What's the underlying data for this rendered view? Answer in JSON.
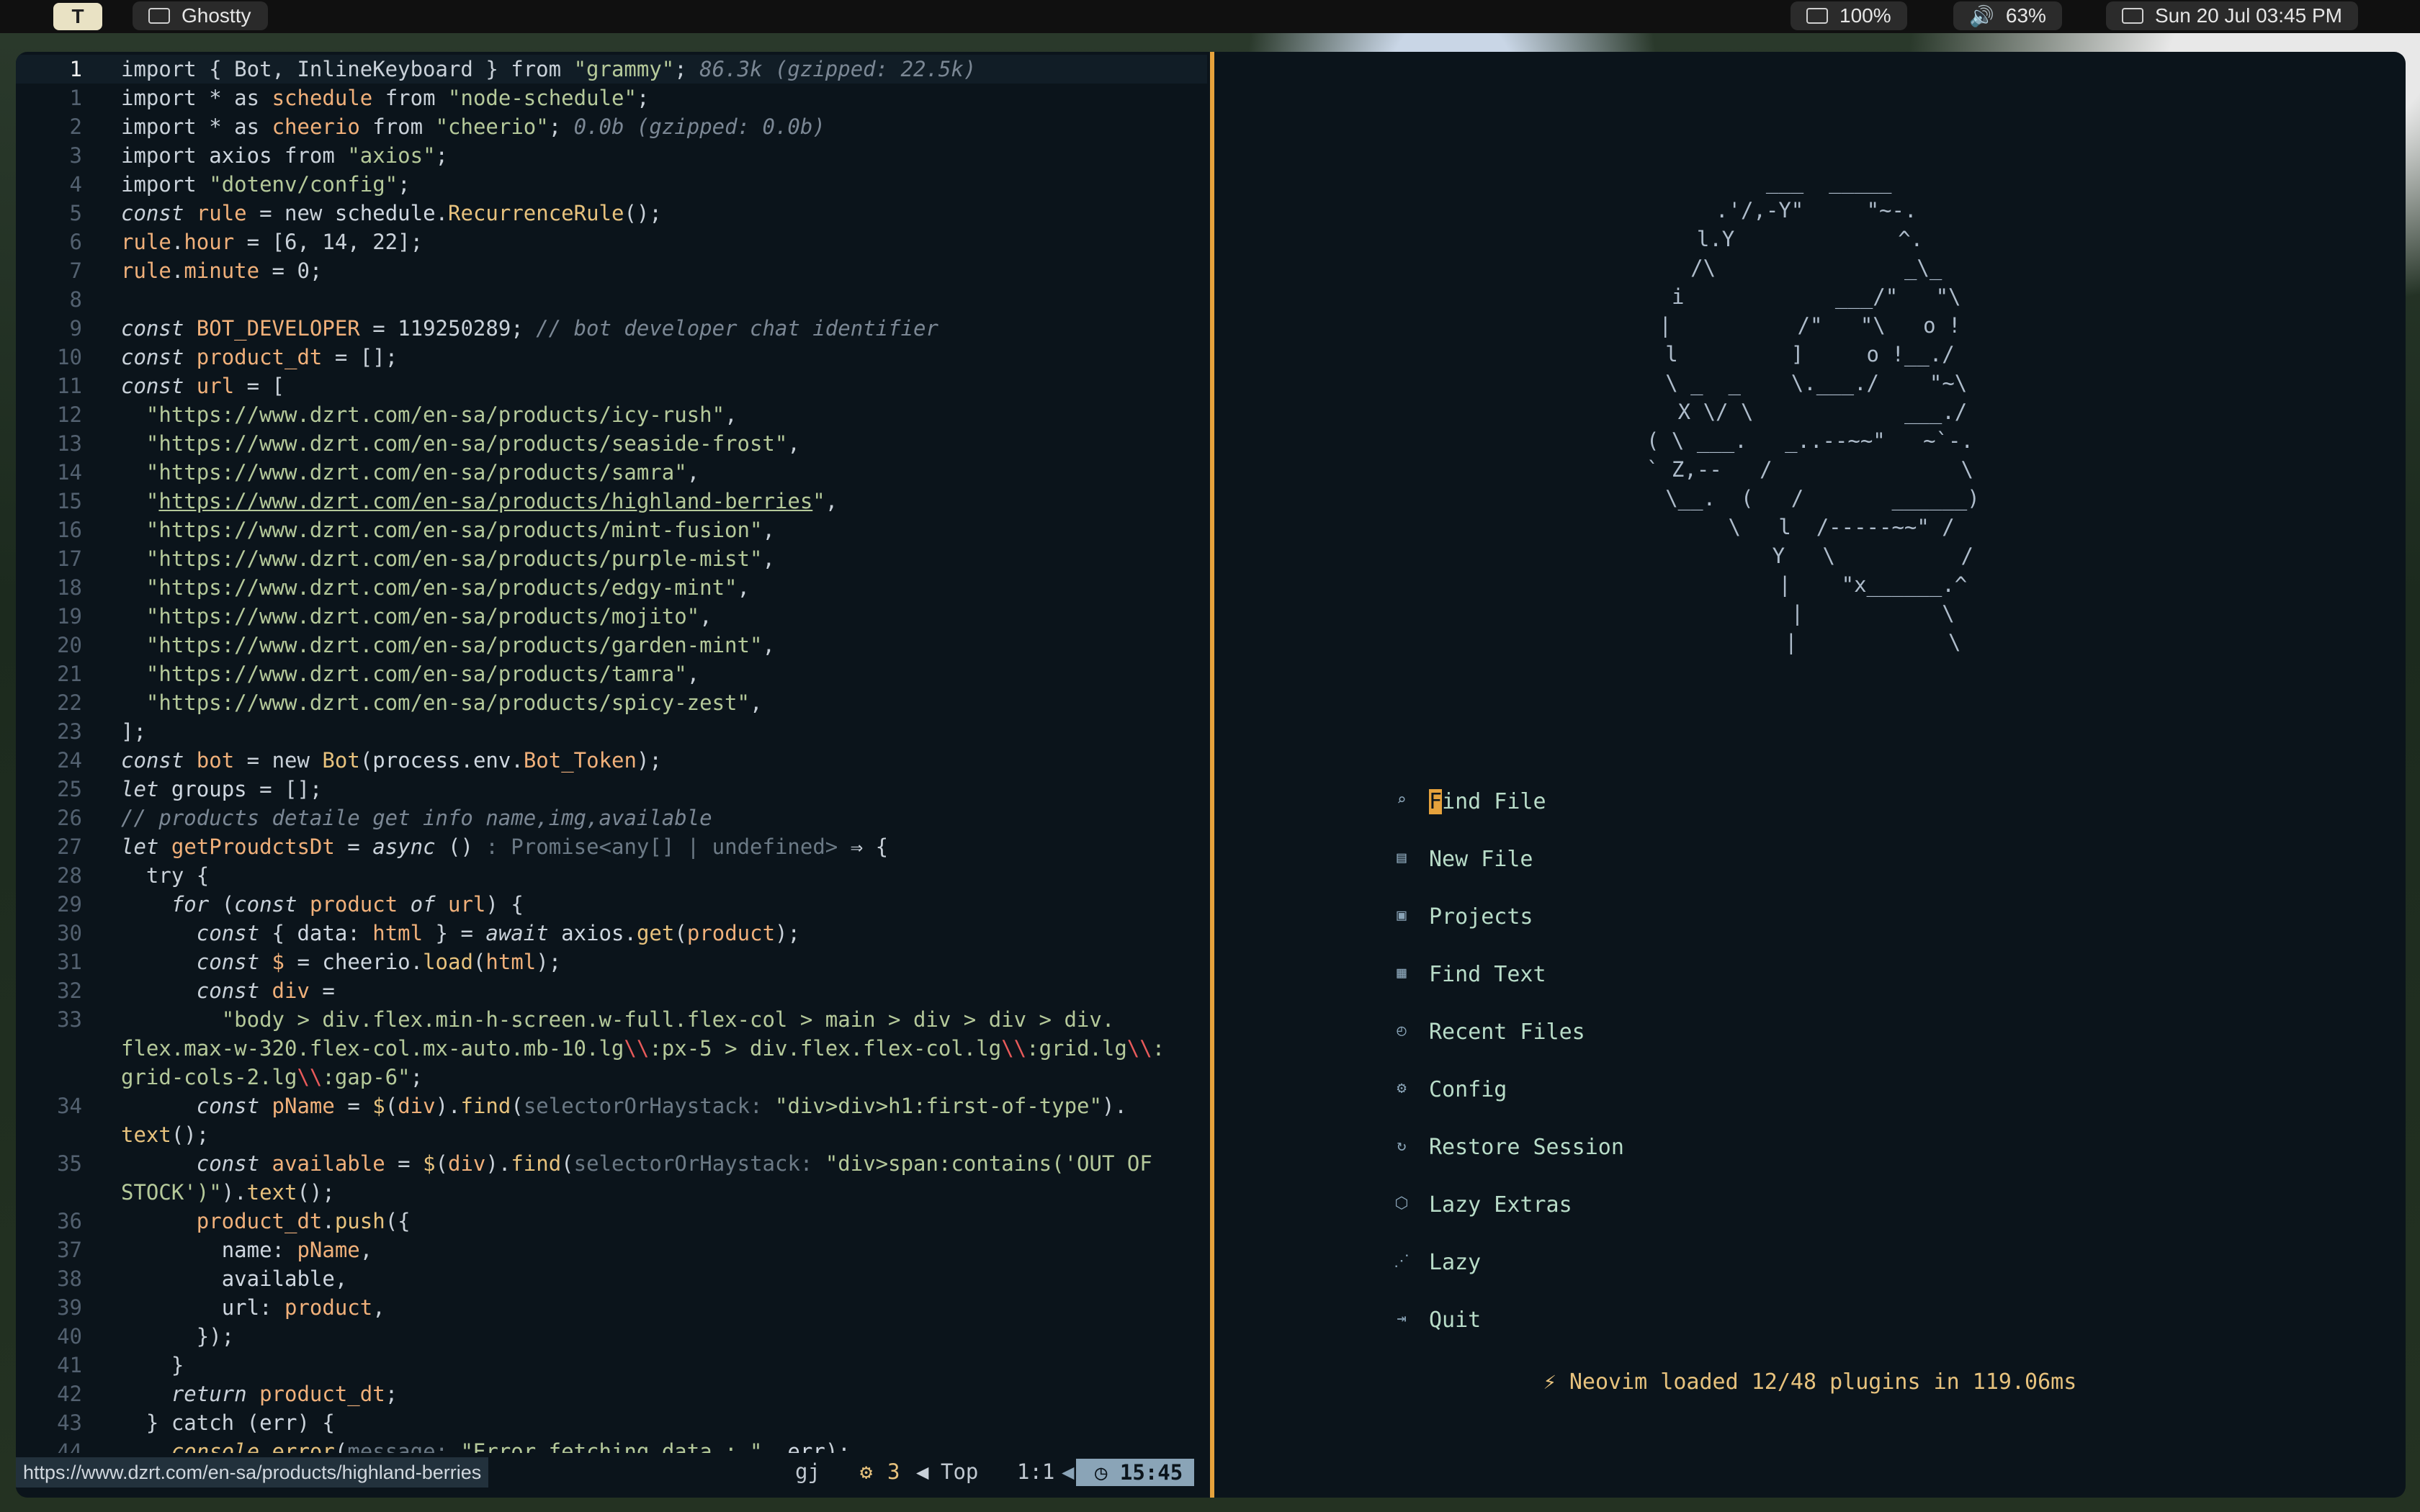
{
  "topbar": {
    "workspace": "T",
    "app_name": "Ghostty",
    "battery": "100%",
    "volume": "63%",
    "datetime": "Sun 20 Jul 03:45 PM"
  },
  "editor": {
    "lines": [
      {
        "n": "1",
        "cur": true,
        "html": "<span class='k'>import</span> { Bot, InlineKeyboard } <span class='k'>from</span> <span class='s'>\"grammy\"</span>; <span class='c'>86.3k (gzipped: 22.5k)</span>"
      },
      {
        "n": "1",
        "html": "<span class='k'>import</span> <span class='k'>*</span> <span class='k'>as</span> <span class='v'>schedule</span> <span class='k'>from</span> <span class='s'>\"node-schedule\"</span>;"
      },
      {
        "n": "2",
        "html": "<span class='k'>import</span> <span class='k'>*</span> <span class='k'>as</span> <span class='v'>cheerio</span> <span class='k'>from</span> <span class='s'>\"cheerio\"</span>; <span class='c'>0.0b (gzipped: 0.0b)</span>"
      },
      {
        "n": "3",
        "html": "<span class='k'>import</span> <span class='f'>axios</span> <span class='k'>from</span> <span class='s'>\"axios\"</span>;"
      },
      {
        "n": "4",
        "html": "<span class='k'>import</span> <span class='s'>\"dotenv/config\"</span>;"
      },
      {
        "n": "5",
        "html": "<span class='c' style='font-style:italic;color:#c9d1d9'>const</span> <span class='v'>rule</span> = <span class='k'>new</span> <span class='f'>schedule</span>.<span class='n'>RecurrenceRule</span>();"
      },
      {
        "n": "6",
        "html": "<span class='v'>rule</span>.<span class='v'>hour</span> = [6, 14, 22];"
      },
      {
        "n": "7",
        "html": "<span class='v'>rule</span>.<span class='v'>minute</span> = 0;"
      },
      {
        "n": "8",
        "html": ""
      },
      {
        "n": "9",
        "html": "<i>const</i> <span class='v'>BOT_DEVELOPER</span> = 119250289; <span class='c'>// bot developer chat identifier</span>"
      },
      {
        "n": "10",
        "html": "<i>const</i> <span class='v'>product_dt</span> = [];"
      },
      {
        "n": "11",
        "html": "<i>const</i> <span class='v'>url</span> = ["
      },
      {
        "n": "12",
        "html": "  <span class='s'>\"https://www.dzrt.com/en-sa/products/icy-rush\"</span>,"
      },
      {
        "n": "13",
        "html": "  <span class='s'>\"https://www.dzrt.com/en-sa/products/seaside-frost\"</span>,"
      },
      {
        "n": "14",
        "html": "  <span class='s'>\"https://www.dzrt.com/en-sa/products/samra\"</span>,"
      },
      {
        "n": "15",
        "html": "  <span class='s'>\"<span class='u'>https://www.dzrt.com/en-sa/products/highland-berries</span>\"</span>,"
      },
      {
        "n": "16",
        "html": "  <span class='s'>\"https://www.dzrt.com/en-sa/products/mint-fusion\"</span>,"
      },
      {
        "n": "17",
        "html": "  <span class='s'>\"https://www.dzrt.com/en-sa/products/purple-mist\"</span>,"
      },
      {
        "n": "18",
        "html": "  <span class='s'>\"https://www.dzrt.com/en-sa/products/edgy-mint\"</span>,"
      },
      {
        "n": "19",
        "html": "  <span class='s'>\"https://www.dzrt.com/en-sa/products/mojito\"</span>,"
      },
      {
        "n": "20",
        "html": "  <span class='s'>\"https://www.dzrt.com/en-sa/products/garden-mint\"</span>,"
      },
      {
        "n": "21",
        "html": "  <span class='s'>\"https://www.dzrt.com/en-sa/products/tamra\"</span>,"
      },
      {
        "n": "22",
        "html": "  <span class='s'>\"https://www.dzrt.com/en-sa/products/spicy-zest\"</span>,"
      },
      {
        "n": "23",
        "html": "];"
      },
      {
        "n": "24",
        "html": "<i>const</i> <span class='v'>bot</span> = <span class='k'>new</span> <span class='n'>Bot</span>(<span class='f'>process</span>.<span class='f'>env</span>.<span class='v'>Bot_Token</span>);"
      },
      {
        "n": "25",
        "html": "<i>let</i> <span class='f'>groups</span> = [];"
      },
      {
        "n": "26",
        "html": "<span class='c'>// products detaile get info name,img,available</span>"
      },
      {
        "n": "27",
        "html": "<i>let</i> <span class='v'>getProudctsDt</span> = <i>async</i> () <span class='h'>: Promise&lt;any[] | undefined&gt;</span> ⇒ {"
      },
      {
        "n": "28",
        "html": "  <span class='k'>try</span> {"
      },
      {
        "n": "29",
        "html": "    <i>for</i> (<i>const</i> <span class='v'>product</span> <i>of</i> <span class='v'>url</span>) {"
      },
      {
        "n": "30",
        "html": "      <i>const</i> { <span class='f'>data</span>: <span class='v'>html</span> } = <i>await</i> <span class='f'>axios</span>.<span class='n'>get</span>(<span class='v'>product</span>);"
      },
      {
        "n": "31",
        "html": "      <i>const</i> <span class='v'>$</span> = <span class='f'>cheerio</span>.<span class='n'>load</span>(<span class='v'>html</span>);"
      },
      {
        "n": "32",
        "html": "      <i>const</i> <span class='v'>div</span> ="
      },
      {
        "n": "33",
        "html": "        <span class='s'>\"body &gt; div.flex.min-h-screen.w-full.flex-col &gt; main &gt; div &gt; div &gt; div.</span>"
      },
      {
        "n": "",
        "html": "<span class='s'>flex.max-w-320.flex-col.mx-auto.mb-10.lg<span class='em'>\\\\</span>:px-5 &gt; div.flex.flex-col.lg<span class='em'>\\\\</span>:grid.lg<span class='em'>\\\\</span>:</span>"
      },
      {
        "n": "",
        "html": "<span class='s'>grid-cols-2.lg<span class='em'>\\\\</span>:gap-6\"</span>;"
      },
      {
        "n": "34",
        "html": "      <i>const</i> <span class='v'>pName</span> = <span class='n'>$</span>(<span class='v'>div</span>).<span class='n'>find</span>(<span class='h'>selectorOrHaystack:</span> <span class='s'>\"div&gt;div&gt;h1:first-of-type\"</span>)."
      },
      {
        "n": "",
        "html": "<span class='n'>text</span>();"
      },
      {
        "n": "35",
        "html": "      <i>const</i> <span class='v'>available</span> = <span class='n'>$</span>(<span class='v'>div</span>).<span class='n'>find</span>(<span class='h'>selectorOrHaystack:</span> <span class='s'>\"div&gt;span:contains('OUT OF</span>"
      },
      {
        "n": "",
        "html": "<span class='s'>STOCK')\"</span>).<span class='n'>text</span>();"
      },
      {
        "n": "36",
        "html": "      <span class='v'>product_dt</span>.<span class='n'>push</span>({"
      },
      {
        "n": "37",
        "html": "        <span class='f'>name</span>: <span class='v'>pName</span>,"
      },
      {
        "n": "38",
        "html": "        <span class='f'>available</span>,"
      },
      {
        "n": "39",
        "html": "        <span class='f'>url</span>: <span class='v'>product</span>,"
      },
      {
        "n": "40",
        "html": "      });"
      },
      {
        "n": "41",
        "html": "    }"
      },
      {
        "n": "42",
        "html": "    <i>return</i> <span class='v'>product_dt</span>;"
      },
      {
        "n": "43",
        "html": "  } <span class='k'>catch</span> (<span class='f'>err</span>) {"
      },
      {
        "n": "44",
        "html": "    <i><span class='n'>console</span></i>.<span class='n'>error</span>(<span class='h'>message:</span> <span class='s'>\"Error fetching data : \"</span>, <span class='f'>err</span>);"
      }
    ],
    "status": {
      "url_tip": "https://www.dzrt.com/en-sa/products/highland-berries",
      "keys": "gj",
      "diagnostics": "3",
      "position": "Top",
      "cursor": "1:1",
      "time": "15:45"
    }
  },
  "dashboard": {
    "logo": "   ___  _____\n .'/,-Y\"     \"~-.\nl.Y             ^.\n /\\               _\\_\n i            ___/\"   \"\\\n|          /\"   \"\\   o !\nl         ]     o !__./\n \\ _  _    \\.___./    \"~\\\n  X \\/ \\            ___./\n( \\ ___.   _..--~~\"   ~`-.\n` Z,--   /               \\\n  \\__.  (   /       ______)\n     \\   l  /-----~~\" /\n          Y   \\          /\n          |    \"x______.^\n          |           \\\n          |            \\",
    "items": [
      {
        "icon": "search-icon",
        "glyph": "⌕",
        "label": "Find File",
        "key": "f"
      },
      {
        "icon": "new-file-icon",
        "glyph": "▤",
        "label": "New File",
        "key": "n"
      },
      {
        "icon": "projects-icon",
        "glyph": "▣",
        "label": "Projects",
        "key": "p"
      },
      {
        "icon": "find-text-icon",
        "glyph": "▦",
        "label": "Find Text",
        "key": "g"
      },
      {
        "icon": "recent-files-icon",
        "glyph": "◴",
        "label": "Recent Files",
        "key": "r"
      },
      {
        "icon": "config-icon",
        "glyph": "⚙",
        "label": "Config",
        "key": "c"
      },
      {
        "icon": "restore-session-icon",
        "glyph": "↻",
        "label": "Restore Session",
        "key": "s"
      },
      {
        "icon": "lazy-extras-icon",
        "glyph": "⬡",
        "label": "Lazy Extras",
        "key": "x"
      },
      {
        "icon": "lazy-icon",
        "glyph": "⋰",
        "label": "Lazy",
        "key": "l"
      },
      {
        "icon": "quit-icon",
        "glyph": "⇥",
        "label": "Quit",
        "key": "q"
      }
    ],
    "footer": "Neovim loaded 12/48 plugins in 119.06ms"
  },
  "colors": {
    "accent": "#e6a23c",
    "background": "#0b141b",
    "menu_label": "#b8dcc8"
  }
}
